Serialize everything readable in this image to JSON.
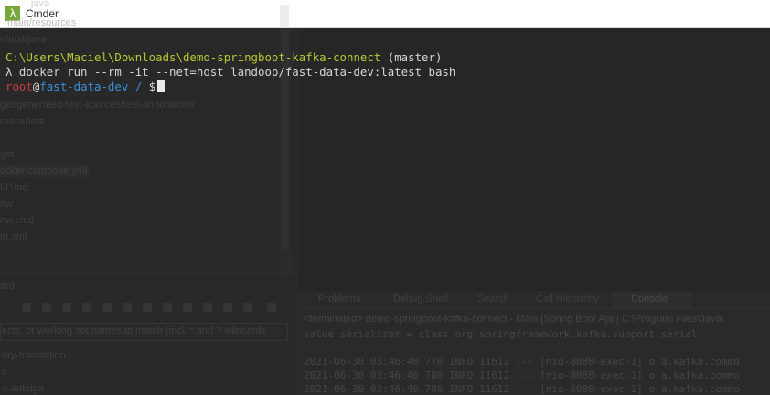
{
  "window": {
    "title": "Cmder",
    "icon": "lambda-icon",
    "accent_color": "#7aa73a",
    "ghost_title_fragment": "java",
    "ghost_title_fragment2": "main/resources"
  },
  "terminal": {
    "cwd_line": {
      "path": "C:\\Users\\Maciel\\Downloads\\demo-springboot-kafka-connect",
      "branch": " (master)"
    },
    "command_line": "λ docker run --rm -it --net=host landoop/fast-data-dev:latest bash",
    "prompt": {
      "user": "root",
      "at": "@",
      "host": "fast-data-dev",
      "dir": " / ",
      "symbol": "$"
    },
    "colors": {
      "path": "#b8c833",
      "user": "#c43c3c",
      "host": "#3b8ed8",
      "background": "#262626"
    }
  },
  "ghost_ide": {
    "tree_items": [
      "n/test/java",
      "reenshots",
      "get/generated-test-sources/test-annotations",
      "get",
      "ocker-compose.yml",
      "LP.md",
      "nw",
      "nw.cmd",
      "m.xml"
    ],
    "left_bottom_title": "ard",
    "search_placeholder": "ects, or working set names to match (incl. * and ? wildcards",
    "left_bottom_items": [
      "ory-translation",
      "s",
      "o-autoiga"
    ],
    "tabs": [
      "Problems",
      "Debug Shell",
      "Search",
      "Call Hierarchy",
      "Console"
    ],
    "console_header": "<terminated> demo-springboot-kafka-connect - Main [Spring Boot App] C:\\Program Files\\Java\\",
    "console_lines": [
      "     value.serializer = class org.springframework.kafka.support.serial",
      "",
      "2021-06-30 03:46:40.778  INFO 11612 --- [nio-8080-exec-1] o.a.kafka.commo",
      "2021-06-30 03:46:40.780  INFO 11612 --- [nio-8080-exec-1] o.a.kafka.commo",
      "2021-06-30 03:46:40.780  INFO 11612 --- [nio-8080-exec-1] o.a.kafka.commo"
    ]
  }
}
